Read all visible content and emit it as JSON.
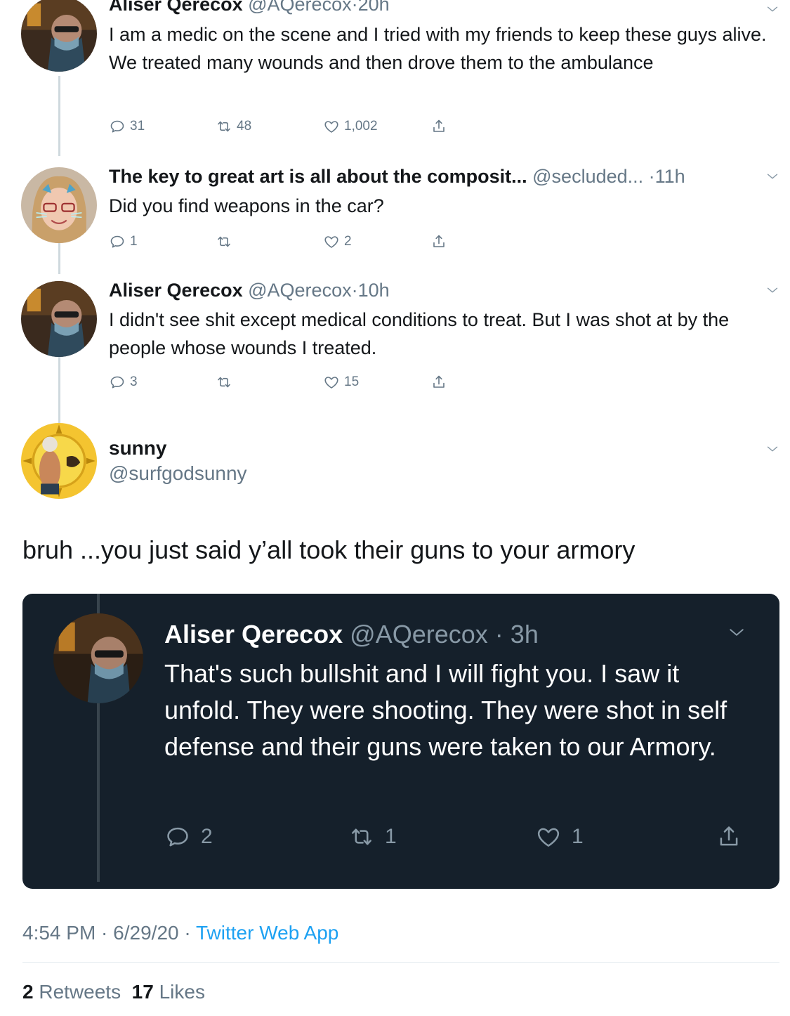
{
  "thread": [
    {
      "name": "Aliser Qerecox",
      "handle": "@AQerecox",
      "time": "20h",
      "text": "I am a medic on the scene and I tried with my friends to keep these guys alive. We treated many wounds and then drove them to the ambulance",
      "replies": "31",
      "retweets": "48",
      "likes": "1,002"
    },
    {
      "name": "The key to great art is all about the composit...",
      "handle": "@secluded...",
      "time": "11h",
      "text": "Did you find weapons in the car?",
      "replies": "1",
      "retweets": "",
      "likes": "2"
    },
    {
      "name": "Aliser Qerecox",
      "handle": "@AQerecox",
      "time": "10h",
      "text": "I didn't see shit except medical conditions to treat. But I was shot at by the people whose wounds I treated.",
      "replies": "3",
      "retweets": "",
      "likes": "15"
    }
  ],
  "main": {
    "name": "sunny",
    "handle": "@surfgodsunny",
    "text": "bruh ...you just said y’all took their guns to your armory"
  },
  "quoted": {
    "name": "Aliser Qerecox",
    "handle": "@AQerecox",
    "time": "3h",
    "text": "That's such bullshit and I will fight you. I saw it unfold. They were shooting. They were shot in self defense and their guns were taken to our Armory.",
    "replies": "2",
    "retweets": "1",
    "likes": "1"
  },
  "footer": {
    "time": "4:54 PM",
    "date": "6/29/20",
    "app": "Twitter Web App",
    "retweets_count": "2",
    "retweets_label": "Retweets",
    "likes_count": "17",
    "likes_label": "Likes"
  },
  "icons": {
    "reply": "reply-icon",
    "retweet": "retweet-icon",
    "like": "heart-icon",
    "share": "share-icon",
    "menu": "chevron-down-icon"
  },
  "colors": {
    "link": "#1da1f2",
    "muted": "#657786",
    "dark_card": "#15202b"
  }
}
